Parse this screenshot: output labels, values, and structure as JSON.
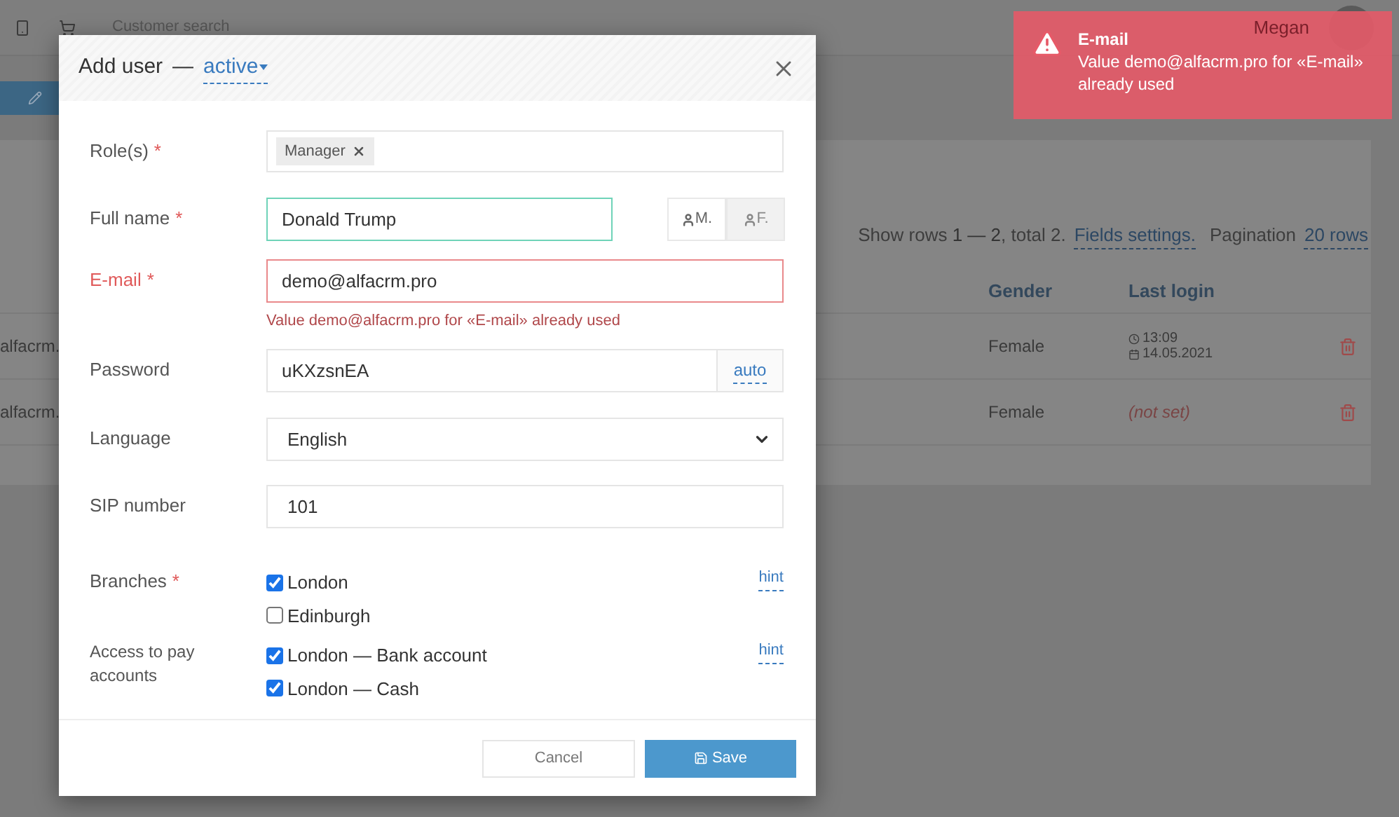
{
  "topbar": {
    "search_placeholder": "Customer search",
    "user_name": "Megan"
  },
  "table": {
    "summary_prefix": "Show rows ",
    "summary_range": "1 — 2",
    "summary_middle": ", total ",
    "summary_total": "2",
    "summary_suffix": ".",
    "fields_link": "Fields settings.",
    "pagination_label": "Pagination",
    "pagination_link": "20 rows",
    "columns": [
      "Gender",
      "Last login"
    ],
    "rows": [
      {
        "column_1": "alfacrm.",
        "gender": "Female",
        "kind": "login",
        "time": "13:09",
        "date": "14.05.2021"
      },
      {
        "column_1": "alfacrm.",
        "gender": "Female",
        "kind": "not_set",
        "last_login": "(not set)"
      }
    ]
  },
  "modal": {
    "title": "Add user",
    "separator": "—",
    "status": "active",
    "roles": {
      "label": "Role(s)",
      "required": "*",
      "tags": [
        "Manager"
      ]
    },
    "full_name": {
      "label": "Full name",
      "required": "*",
      "value": "Donald Trump",
      "focused": true,
      "genders": [
        {
          "label": "M.",
          "selected": false
        },
        {
          "label": "F.",
          "selected": true
        }
      ]
    },
    "email": {
      "label": "E-mail",
      "required": "*",
      "value": "demo@alfacrm.pro",
      "error": "Value demo@alfacrm.pro for «E-mail» already used"
    },
    "password": {
      "label": "Password",
      "value": "uKXzsnEA",
      "addon": "auto"
    },
    "language": {
      "label": "Language",
      "value": "English"
    },
    "sip": {
      "label": "SIP number",
      "value": "101"
    },
    "branches": {
      "label": "Branches",
      "required": "*",
      "hint": "hint",
      "options": [
        {
          "label": "London",
          "checked": true
        },
        {
          "label": "Edinburgh",
          "checked": false
        }
      ]
    },
    "pay_accounts": {
      "label": "Access to pay accounts",
      "hint": "hint",
      "options": [
        {
          "label": "London — Bank account",
          "checked": true
        },
        {
          "label": "London — Cash",
          "checked": true
        }
      ]
    },
    "buttons": {
      "cancel": "Cancel",
      "save": "Save"
    }
  },
  "toast": {
    "title": "E-mail",
    "message": "Value demo@alfacrm.pro for «E-mail» already used"
  }
}
